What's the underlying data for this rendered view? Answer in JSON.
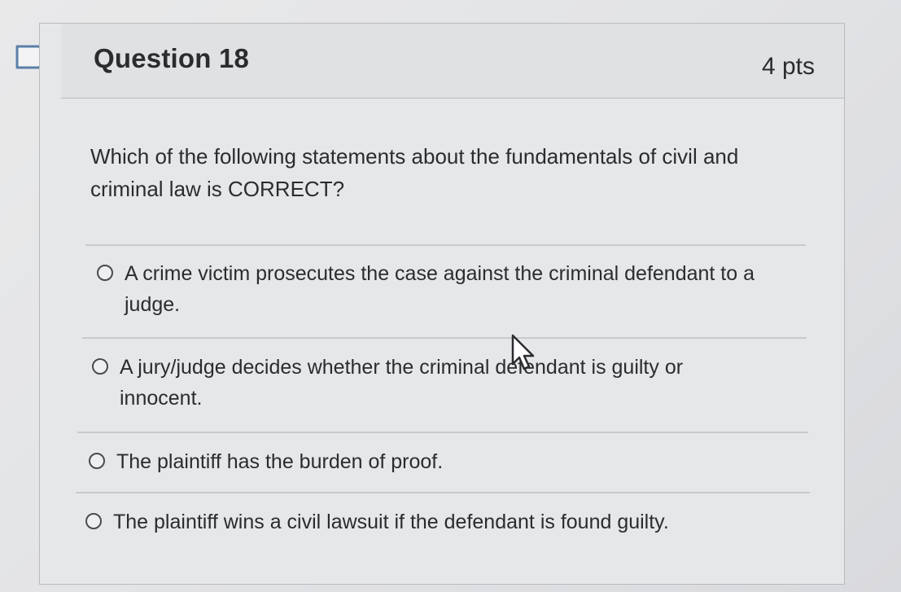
{
  "question": {
    "title": "Question 18",
    "points": "4 pts",
    "text": "Which of the following statements about the fundamentals of civil and criminal law is CORRECT?",
    "flag_icon": "flag-icon",
    "answers": [
      {
        "label": "A crime victim prosecutes the case against the criminal defendant to a judge.",
        "selected": false
      },
      {
        "label": "A jury/judge decides whether the criminal defendant is guilty or innocent.",
        "selected": false
      },
      {
        "label": "The plaintiff has the burden of proof.",
        "selected": false
      },
      {
        "label": "The plaintiff wins a civil lawsuit if the defendant is found guilty.",
        "selected": false
      }
    ]
  },
  "colors": {
    "background": "#e3e4e6",
    "border": "#b9babd",
    "text": "#2b2c30"
  }
}
